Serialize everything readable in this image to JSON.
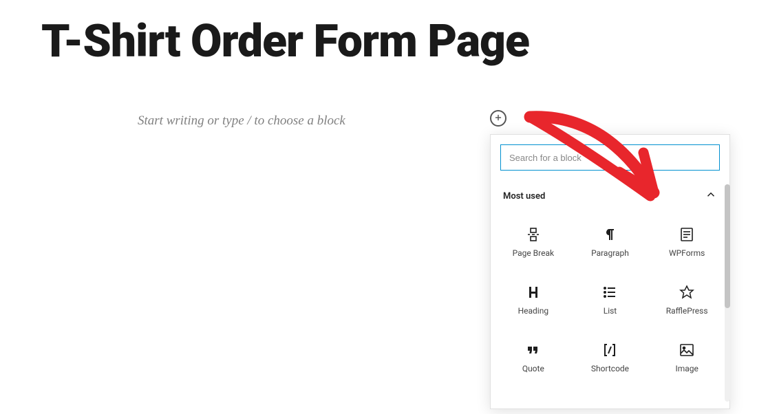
{
  "title": "T-Shirt Order Form Page",
  "content": {
    "placeholder": "Start writing or type / to choose a block"
  },
  "inserter": {
    "search_placeholder": "Search for a block",
    "section_title": "Most used",
    "blocks": [
      {
        "label": "Page Break",
        "icon": "pagebreak"
      },
      {
        "label": "Paragraph",
        "icon": "paragraph"
      },
      {
        "label": "WPForms",
        "icon": "wpforms"
      },
      {
        "label": "Heading",
        "icon": "heading"
      },
      {
        "label": "List",
        "icon": "list"
      },
      {
        "label": "RafflePress",
        "icon": "rafflepress"
      },
      {
        "label": "Quote",
        "icon": "quote"
      },
      {
        "label": "Shortcode",
        "icon": "shortcode"
      },
      {
        "label": "Image",
        "icon": "image"
      }
    ]
  }
}
